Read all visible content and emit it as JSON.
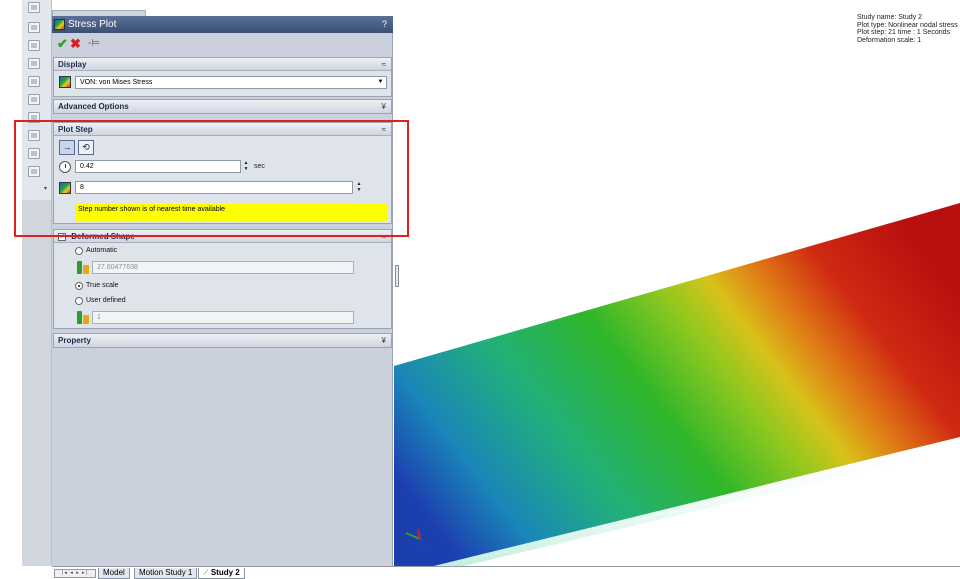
{
  "panel": {
    "title": "Stress Plot",
    "help": "?"
  },
  "display": {
    "header": "Display",
    "toggle": "≈",
    "component": "VON: von Mises Stress"
  },
  "advanced": {
    "header": "Advanced Options",
    "toggle": "¥"
  },
  "plot_step": {
    "header": "Plot Step",
    "toggle": "≈",
    "time_value": "0.42",
    "time_unit": "sec",
    "step_value": "8",
    "note": "Step number shown is of nearest time available"
  },
  "deformed": {
    "header": "Deformed Shape",
    "toggle": "≈",
    "automatic_label": "Automatic",
    "automatic_value": "27.60477638",
    "true_scale_label": "True scale",
    "user_defined_label": "User defined",
    "user_value": "1",
    "selected": "true_scale"
  },
  "property": {
    "header": "Property",
    "toggle": "¥"
  },
  "study_info": {
    "line1": "Study name: Study 2",
    "line2": "Plot type: Nonlinear nodal stress",
    "line3": "Plot step: 21   time : 1 Seconds",
    "line4": "Deformation scale: 1"
  },
  "tabs": {
    "nav": "|◂ ◂ ▸ ▸|",
    "items": [
      {
        "label": "Model"
      },
      {
        "label": "Motion Study 1"
      },
      {
        "label": "Study 2"
      }
    ],
    "active": "Study 2"
  },
  "colors": {
    "accent_title": "#3b4f74",
    "highlight_box": "#e02020",
    "note_bg": "#ffff00",
    "stress_low": "#1c3fb0",
    "stress_mid": "#2db52d",
    "stress_high": "#b80f0f"
  },
  "icons": {
    "ok": "check-icon",
    "cancel": "x-icon",
    "pin": "pushpin-icon"
  }
}
